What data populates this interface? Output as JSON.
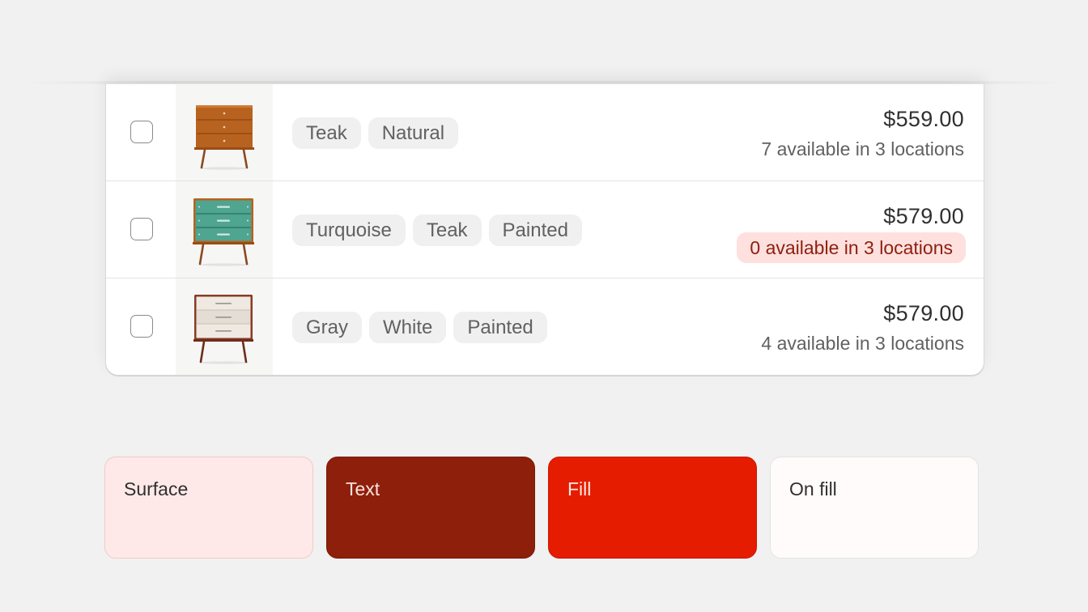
{
  "products": [
    {
      "tags": [
        "Teak",
        "Natural"
      ],
      "price": "$559.00",
      "availability": "7 available in 3 locations",
      "critical": false,
      "image_icon": "teak-dresser-icon"
    },
    {
      "tags": [
        "Turquoise",
        "Teak",
        "Painted"
      ],
      "price": "$579.00",
      "availability": "0 available in 3 locations",
      "critical": true,
      "image_icon": "turquoise-dresser-icon"
    },
    {
      "tags": [
        "Gray",
        "White",
        "Painted"
      ],
      "price": "$579.00",
      "availability": "4 available in 3 locations",
      "critical": false,
      "image_icon": "white-dresser-icon"
    }
  ],
  "swatches": [
    {
      "label": "Surface",
      "color": "#fee9e8",
      "text_color": "#303030",
      "border": "#f3c9c7"
    },
    {
      "label": "Text",
      "color": "#8e1f0b",
      "text_color": "#fbe3df",
      "border": "#7a1a09"
    },
    {
      "label": "Fill",
      "color": "#e51c00",
      "text_color": "#ffe9e5",
      "border": "#c91800"
    },
    {
      "label": "On fill",
      "color": "#fffbfb",
      "text_color": "#303030",
      "border": "#e3e3e3"
    }
  ],
  "colors": {
    "critical_surface": "#fee0df",
    "critical_text": "#8e1f0b",
    "background": "#f1f1f1"
  }
}
